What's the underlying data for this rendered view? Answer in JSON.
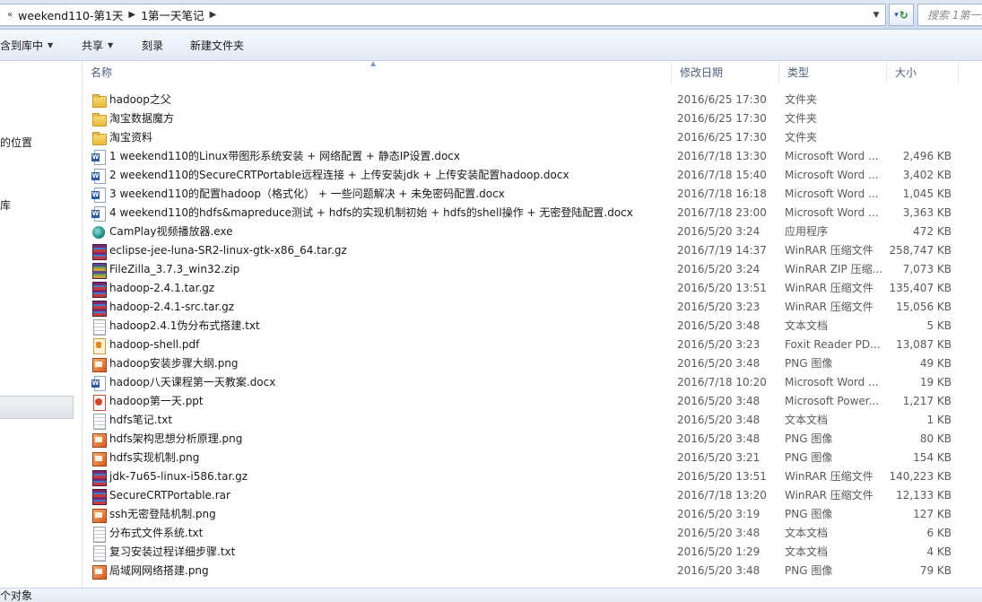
{
  "address": {
    "separator_icon": "chevron-right",
    "crumbs": [
      "weekend110-第1天",
      "1第一天笔记"
    ],
    "search_placeholder": "搜索 1第一..."
  },
  "toolbar": {
    "include_library": "含到库中",
    "share": "共享",
    "burn": "刻录",
    "new_folder": "新建文件夹"
  },
  "nav": {
    "items": [
      "的位置",
      "库"
    ]
  },
  "columns": {
    "name": "名称",
    "date": "修改日期",
    "type": "类型",
    "size": "大小"
  },
  "files": [
    {
      "icon": "folder",
      "name": "hadoop之父",
      "date": "2016/6/25 17:30",
      "type": "文件夹",
      "size": ""
    },
    {
      "icon": "folder",
      "name": "淘宝数据魔方",
      "date": "2016/6/25 17:30",
      "type": "文件夹",
      "size": ""
    },
    {
      "icon": "folder",
      "name": "淘宝资料",
      "date": "2016/6/25 17:30",
      "type": "文件夹",
      "size": ""
    },
    {
      "icon": "word",
      "name": "1  weekend110的Linux带图形系统安装 + 网络配置 + 静态IP设置.docx",
      "date": "2016/7/18 13:30",
      "type": "Microsoft Word ...",
      "size": "2,496 KB"
    },
    {
      "icon": "word",
      "name": "2    weekend110的SecureCRTPortable远程连接 + 上传安装jdk + 上传安装配置hadoop.docx",
      "date": "2016/7/18 15:40",
      "type": "Microsoft Word ...",
      "size": "3,402 KB"
    },
    {
      "icon": "word",
      "name": "3  weekend110的配置hadoop（格式化）  +  一些问题解决 + 未免密码配置.docx",
      "date": "2016/7/18 16:18",
      "type": "Microsoft Word ...",
      "size": "1,045 KB"
    },
    {
      "icon": "word",
      "name": "4  weekend110的hdfs&mapreduce测试  + hdfs的实现机制初始  + hdfs的shell操作  +  无密登陆配置.docx",
      "date": "2016/7/18 23:00",
      "type": "Microsoft Word ...",
      "size": "3,363 KB"
    },
    {
      "icon": "exe",
      "name": "CamPlay视频播放器.exe",
      "date": "2016/5/20 3:24",
      "type": "应用程序",
      "size": "472 KB"
    },
    {
      "icon": "rar",
      "name": "eclipse-jee-luna-SR2-linux-gtk-x86_64.tar.gz",
      "date": "2016/7/19 14:37",
      "type": "WinRAR 压缩文件",
      "size": "258,747 KB"
    },
    {
      "icon": "zip",
      "name": "FileZilla_3.7.3_win32.zip",
      "date": "2016/5/20 3:24",
      "type": "WinRAR ZIP 压缩...",
      "size": "7,073 KB"
    },
    {
      "icon": "rar",
      "name": "hadoop-2.4.1.tar.gz",
      "date": "2016/5/20 13:51",
      "type": "WinRAR 压缩文件",
      "size": "135,407 KB"
    },
    {
      "icon": "rar",
      "name": "hadoop-2.4.1-src.tar.gz",
      "date": "2016/5/20 3:23",
      "type": "WinRAR 压缩文件",
      "size": "15,056 KB"
    },
    {
      "icon": "txt",
      "name": "hadoop2.4.1伪分布式搭建.txt",
      "date": "2016/5/20 3:48",
      "type": "文本文档",
      "size": "5 KB"
    },
    {
      "icon": "pdf",
      "name": "hadoop-shell.pdf",
      "date": "2016/5/20 3:23",
      "type": "Foxit Reader PD...",
      "size": "13,087 KB"
    },
    {
      "icon": "png",
      "name": "hadoop安装步骤大纲.png",
      "date": "2016/5/20 3:48",
      "type": "PNG 图像",
      "size": "49 KB"
    },
    {
      "icon": "word",
      "name": "hadoop八天课程第一天教案.docx",
      "date": "2016/7/18 10:20",
      "type": "Microsoft Word ...",
      "size": "19 KB"
    },
    {
      "icon": "ppt",
      "name": "hadoop第一天.ppt",
      "date": "2016/5/20 3:48",
      "type": "Microsoft Power...",
      "size": "1,217 KB"
    },
    {
      "icon": "txt",
      "name": "hdfs笔记.txt",
      "date": "2016/5/20 3:48",
      "type": "文本文档",
      "size": "1 KB"
    },
    {
      "icon": "png",
      "name": "hdfs架构思想分析原理.png",
      "date": "2016/5/20 3:48",
      "type": "PNG 图像",
      "size": "80 KB"
    },
    {
      "icon": "png",
      "name": "hdfs实现机制.png",
      "date": "2016/5/20 3:21",
      "type": "PNG 图像",
      "size": "154 KB"
    },
    {
      "icon": "rar",
      "name": "jdk-7u65-linux-i586.tar.gz",
      "date": "2016/5/20 13:51",
      "type": "WinRAR 压缩文件",
      "size": "140,223 KB"
    },
    {
      "icon": "rar",
      "name": "SecureCRTPortable.rar",
      "date": "2016/7/18 13:20",
      "type": "WinRAR 压缩文件",
      "size": "12,133 KB"
    },
    {
      "icon": "png",
      "name": "ssh无密登陆机制.png",
      "date": "2016/5/20 3:19",
      "type": "PNG 图像",
      "size": "127 KB"
    },
    {
      "icon": "txt",
      "name": "分布式文件系统.txt",
      "date": "2016/5/20 3:48",
      "type": "文本文档",
      "size": "6 KB"
    },
    {
      "icon": "txt",
      "name": "复习安装过程详细步骤.txt",
      "date": "2016/5/20 1:29",
      "type": "文本文档",
      "size": "4 KB"
    },
    {
      "icon": "png",
      "name": "局域网网络搭建.png",
      "date": "2016/5/20 3:48",
      "type": "PNG 图像",
      "size": "79 KB"
    }
  ],
  "status": {
    "text": "个对象"
  }
}
